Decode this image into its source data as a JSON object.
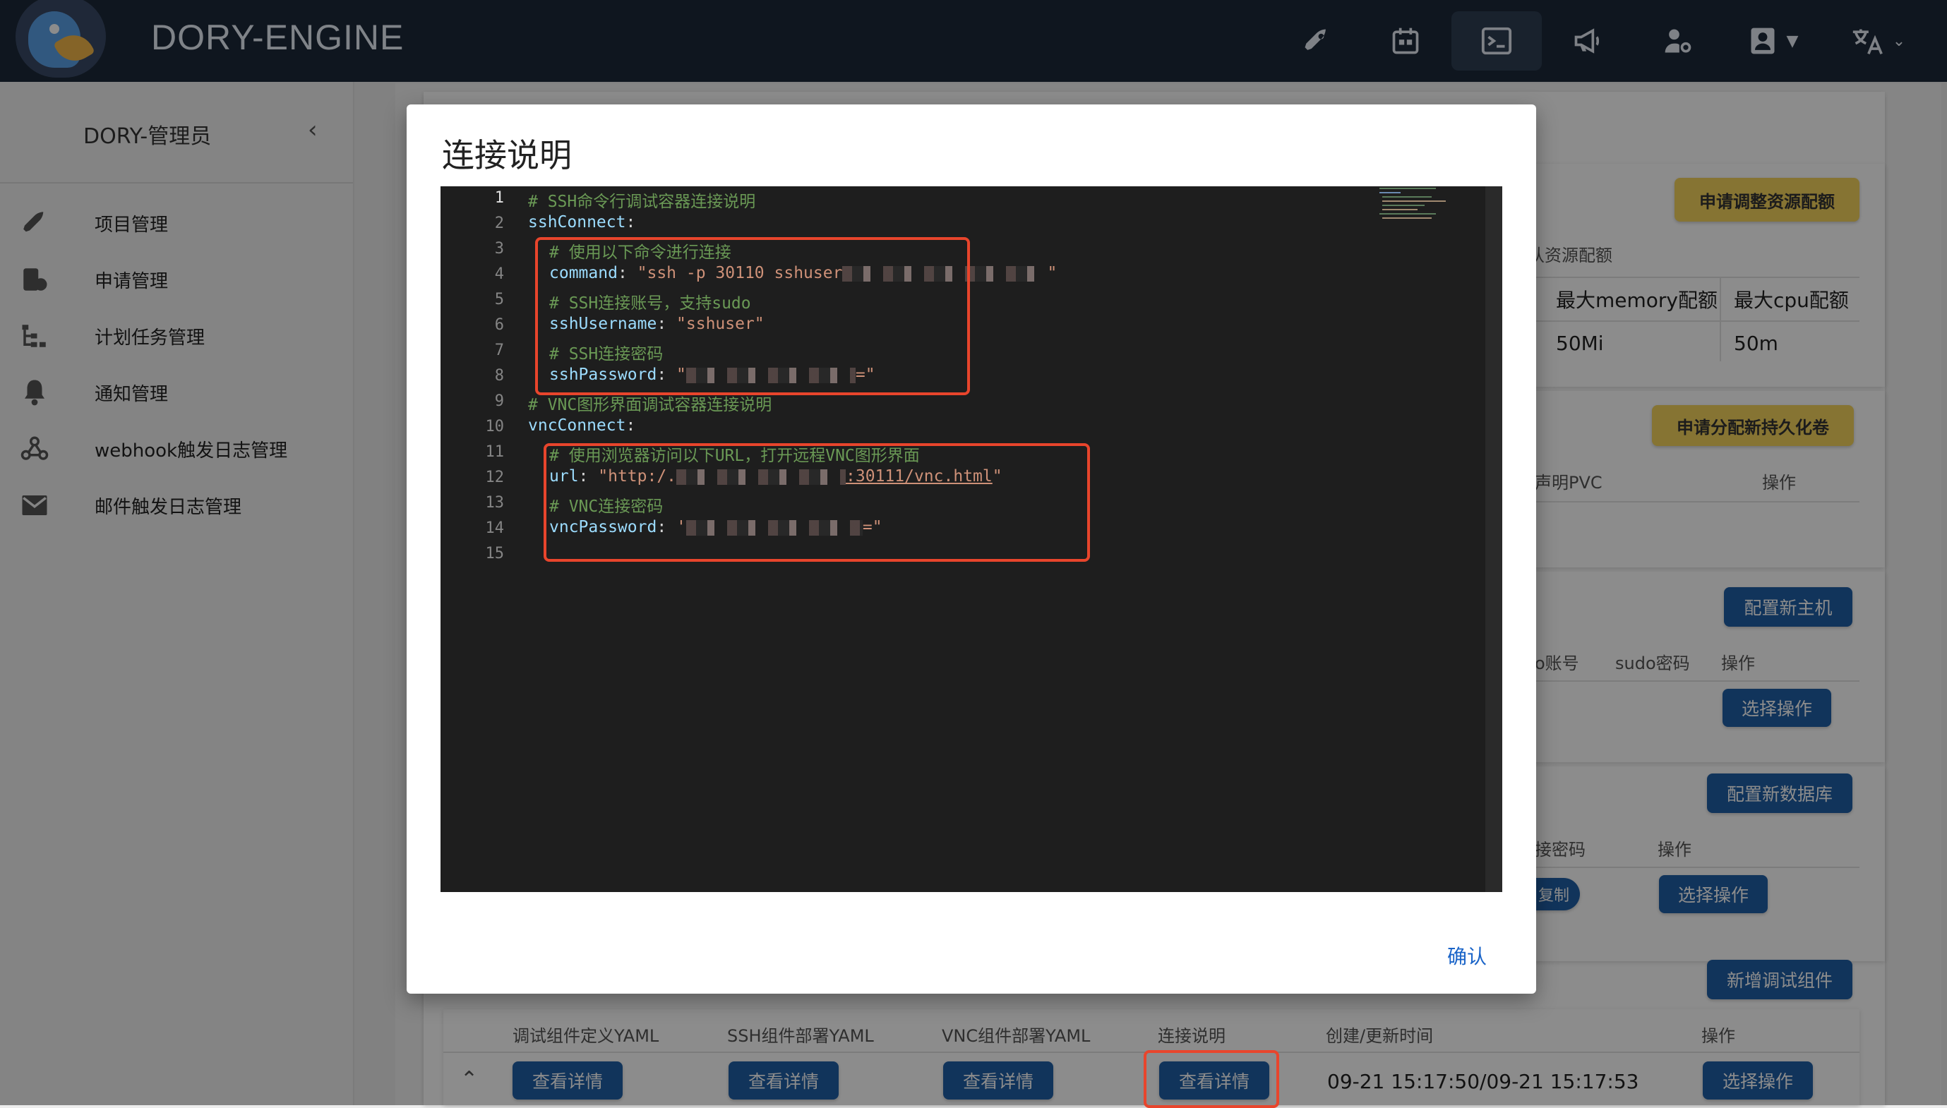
{
  "app": {
    "title": "DORY-ENGINE"
  },
  "topbar": {
    "icons": [
      {
        "name": "rocket-icon",
        "glyph": "🚀"
      },
      {
        "name": "calendar-icon",
        "glyph": "📅"
      },
      {
        "name": "terminal-icon",
        "glyph": ">_"
      },
      {
        "name": "megaphone-icon",
        "glyph": "📣"
      },
      {
        "name": "user-gear-icon",
        "glyph": "👤"
      },
      {
        "name": "account-icon",
        "glyph": "▣"
      },
      {
        "name": "translate-icon",
        "glyph": "文A"
      }
    ]
  },
  "sidebar": {
    "user": "DORY-管理员",
    "collapse": "‹",
    "items": [
      {
        "label": "项目管理",
        "icon": "rocket-icon",
        "glyph": "🚀"
      },
      {
        "label": "申请管理",
        "icon": "stamp-icon",
        "glyph": "✉"
      },
      {
        "label": "计划任务管理",
        "icon": "tree-icon",
        "glyph": "☰"
      },
      {
        "label": "通知管理",
        "icon": "bell-icon",
        "glyph": "🔔"
      },
      {
        "label": "webhook触发日志管理",
        "icon": "webhook-icon",
        "glyph": "⚭"
      },
      {
        "label": "邮件触发日志管理",
        "icon": "mail-icon",
        "glyph": "✉"
      }
    ]
  },
  "background": {
    "resource_btn": "申请调整资源配额",
    "resource_caption": "认资源配额",
    "resource_headers": [
      "最大memory配额",
      "最大cpu配额"
    ],
    "resource_values": [
      "50Mi",
      "50m"
    ],
    "pvc_btn": "申请分配新持久化卷",
    "pvc_headers": [
      "声明PVC",
      "操作"
    ],
    "host_btn": "配置新主机",
    "host_headers": [
      "o账号",
      "sudo密码",
      "操作"
    ],
    "host_action": "选择操作",
    "db_btn": "配置新数据库",
    "db_headers": [
      "接密码",
      "操作"
    ],
    "db_copy": "复制",
    "db_action": "选择操作",
    "debug_btn": "新增调试组件",
    "debug_headers": [
      "调试组件定义YAML",
      "SSH组件部署YAML",
      "VNC组件部署YAML",
      "连接说明",
      "创建/更新时间",
      "操作"
    ],
    "debug_row": {
      "expand": "⌃",
      "detail1": "查看详情",
      "detail2": "查看详情",
      "detail3": "查看详情",
      "detail4": "查看详情",
      "time": "09-21 15:17:50/09-21 15:17:53",
      "action": "选择操作"
    }
  },
  "modal": {
    "title": "连接说明",
    "lines": [
      {
        "n": "1",
        "c": "# SSH命令行调试容器连接说明"
      },
      {
        "n": "2",
        "k": "sshConnect",
        "p": ":"
      },
      {
        "n": "3",
        "c": "# 使用以下命令进行连接"
      },
      {
        "n": "4",
        "k": "command",
        "p": ": ",
        "s": "\"ssh -p 30110 sshuser"
      },
      {
        "n": "5",
        "c": "# SSH连接账号，支持sudo"
      },
      {
        "n": "6",
        "k": "sshUsername",
        "p": ": ",
        "s": "\"sshuser\""
      },
      {
        "n": "7",
        "c": "# SSH连接密码"
      },
      {
        "n": "8",
        "k": "sshPassword",
        "p": ": ",
        "s": "\""
      },
      {
        "n": "9",
        "c": "# VNC图形界面调试容器连接说明"
      },
      {
        "n": "10",
        "k": "vncConnect",
        "p": ":"
      },
      {
        "n": "11",
        "c": "# 使用浏览器访问以下URL，打开远程VNC图形界面"
      },
      {
        "n": "12",
        "k": "url",
        "p": ": ",
        "s": "\"http:/."
      },
      {
        "n": "13",
        "c": "# VNC连接密码"
      },
      {
        "n": "14",
        "k": "vncPassword",
        "p": ": ",
        "s": "'"
      },
      {
        "n": "15"
      }
    ],
    "line4_tail": "\"",
    "line8_tail": "=\"",
    "line12_tail": ":30111/vnc.html",
    "line12_end": "\"",
    "line14_tail": "=\"",
    "confirm": "确认"
  }
}
